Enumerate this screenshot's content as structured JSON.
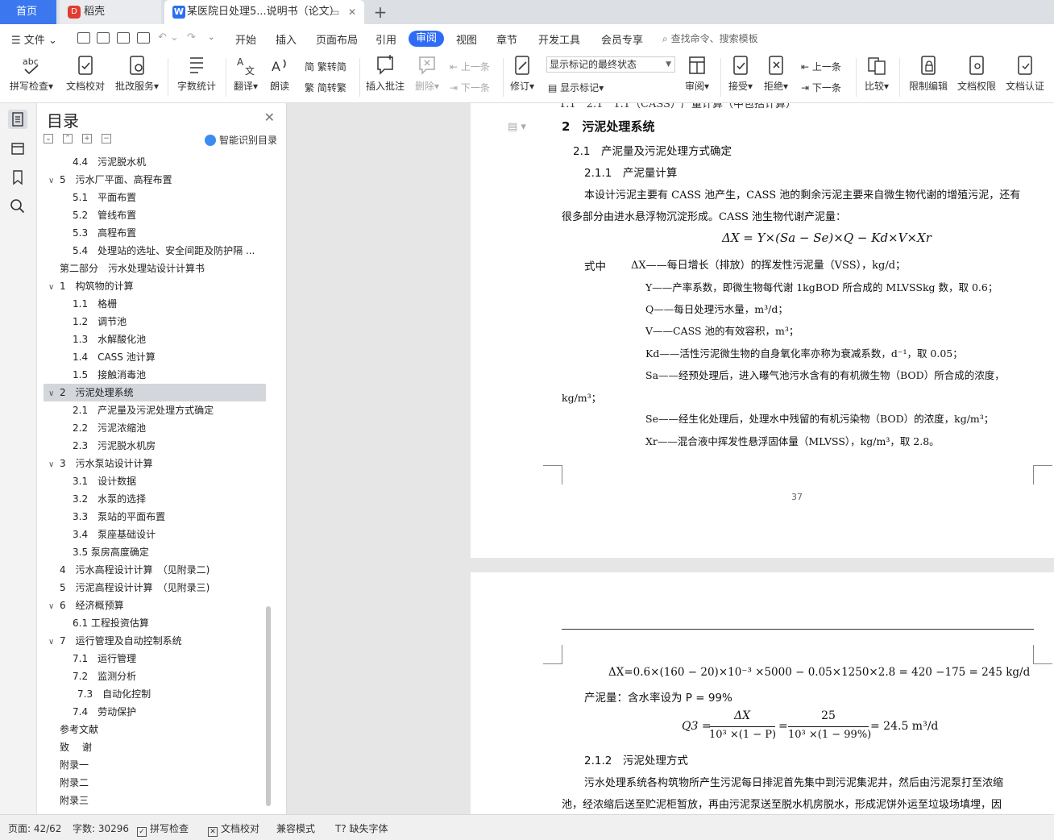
{
  "tabs": {
    "home": "首页",
    "daoke": "稻壳",
    "document": "某医院日处理5...说明书（论文）"
  },
  "menu": {
    "file": "文件",
    "items": [
      "开始",
      "插入",
      "页面布局",
      "引用",
      "审阅",
      "视图",
      "章节",
      "开发工具",
      "会员专享"
    ],
    "active": "审阅",
    "search": "查找命令、搜索模板"
  },
  "ribbon": {
    "spell_check": "拼写检查",
    "doc_check": "文档校对",
    "annot_service": "批改服务",
    "word_count": "字数统计",
    "translate": "翻译",
    "read_aloud": "朗读",
    "to_traditional": "繁转简",
    "to_simplified": "简转繁",
    "insert_comment": "插入批注",
    "delete": "删除",
    "prev_comment": "上一条",
    "next_comment": "下一条",
    "track": "修订",
    "markup_select": "显示标记的最终状态",
    "show_markup": "显示标记",
    "review": "审阅",
    "accept": "接受",
    "reject": "拒绝",
    "prev_change": "上一条",
    "next_change": "下一条",
    "compare": "比较",
    "restrict_edit": "限制编辑",
    "doc_permission": "文档权限",
    "doc_auth": "文档认证"
  },
  "toc": {
    "title": "目录",
    "smart": "智能识别目录",
    "items": [
      {
        "text": "4.4　污泥脱水机",
        "level": 2,
        "arrow": ""
      },
      {
        "text": "5　污水厂平面、高程布置",
        "level": 1,
        "arrow": "v"
      },
      {
        "text": "5.1　平面布置",
        "level": 2,
        "arrow": ""
      },
      {
        "text": "5.2　管线布置",
        "level": 2,
        "arrow": ""
      },
      {
        "text": "5.3　高程布置",
        "level": 2,
        "arrow": ""
      },
      {
        "text": "5.4　处理站的选址、安全间距及防护隔 ...",
        "level": 2,
        "arrow": ""
      },
      {
        "text": "第二部分　污水处理站设计计算书",
        "level": 0,
        "arrow": ""
      },
      {
        "text": "1　构筑物的计算",
        "level": 1,
        "arrow": "v"
      },
      {
        "text": "1.1　格栅",
        "level": 2,
        "arrow": ""
      },
      {
        "text": "1.2　调节池",
        "level": 2,
        "arrow": ""
      },
      {
        "text": "1.3　水解酸化池",
        "level": 2,
        "arrow": ""
      },
      {
        "text": "1.4　CASS 池计算",
        "level": 2,
        "arrow": ""
      },
      {
        "text": "1.5　接触消毒池",
        "level": 2,
        "arrow": ""
      },
      {
        "text": "2　污泥处理系统",
        "level": 1,
        "arrow": "v",
        "selected": true
      },
      {
        "text": "2.1　产泥量及污泥处理方式确定",
        "level": 2,
        "arrow": ""
      },
      {
        "text": "2.2　污泥浓缩池",
        "level": 2,
        "arrow": ""
      },
      {
        "text": "2.3　污泥脱水机房",
        "level": 2,
        "arrow": ""
      },
      {
        "text": "3　污水泵站设计计算",
        "level": 1,
        "arrow": "v"
      },
      {
        "text": "3.1　设计数据",
        "level": 2,
        "arrow": ""
      },
      {
        "text": "3.2　水泵的选择",
        "level": 2,
        "arrow": ""
      },
      {
        "text": "3.3　泵站的平面布置",
        "level": 2,
        "arrow": ""
      },
      {
        "text": "3.4　泵座基础设计",
        "level": 2,
        "arrow": ""
      },
      {
        "text": "3.5 泵房高度确定",
        "level": 2,
        "arrow": ""
      },
      {
        "text": "4　污水高程设计计算　（见附录二)",
        "level": 0.5,
        "arrow": ""
      },
      {
        "text": "5　污泥高程设计计算　（见附录三)",
        "level": 0.5,
        "arrow": ""
      },
      {
        "text": "6　经济概预算",
        "level": 1,
        "arrow": "v"
      },
      {
        "text": "6.1 工程投资估算",
        "level": 2,
        "arrow": ""
      },
      {
        "text": "7　运行管理及自动控制系统",
        "level": 1,
        "arrow": "v"
      },
      {
        "text": "7.1　运行管理",
        "level": 2,
        "arrow": ""
      },
      {
        "text": "7.2　监测分析",
        "level": 2,
        "arrow": ""
      },
      {
        "text": "7.3　自动化控制",
        "level": 2.3,
        "arrow": ""
      },
      {
        "text": "7.4　劳动保护",
        "level": 2,
        "arrow": ""
      },
      {
        "text": "参考文献",
        "level": 0,
        "arrow": ""
      },
      {
        "text": "致　 谢",
        "level": 0,
        "arrow": ""
      },
      {
        "text": "附录一",
        "level": 0,
        "arrow": ""
      },
      {
        "text": "附录二",
        "level": 0,
        "arrow": ""
      },
      {
        "text": "附录三",
        "level": 0,
        "arrow": ""
      }
    ]
  },
  "page1": {
    "cut_top": "1.1　2.1　1.1（CASS）产量计算（中包括计算）",
    "h2": "2　污泥处理系统",
    "h3": "2.1　产泥量及污泥处理方式确定",
    "h4": "2.1.1　产泥量计算",
    "para1_l1": "本设计污泥主要有 CASS 池产生，CASS 池的剩余污泥主要来自微生物代谢的增殖污泥，还有",
    "para1_l2": "很多部分由进水悬浮物沉淀形成。CASS 池生物代谢产泥量：",
    "formula1": "ΔX = Y×(Sa − Se)×Q − Kd×V×Xr",
    "where_label": "式中",
    "def1": "ΔX——每日增长（排放）的挥发性污泥量（VSS），kg/d；",
    "def2": "Y——产率系数，即微生物每代谢 1kgBOD 所合成的 MLVSSkg 数，取 0.6；",
    "def3": "Q——每日处理污水量，m³/d；",
    "def4": "V——CASS 池的有效容积，m³；",
    "def5": "Kd——活性污泥微生物的自身氧化率亦称为衰减系数，d⁻¹，取 0.05；",
    "def6_l1": "Sa——经预处理后，进入曝气池污水含有的有机微生物（BOD）所合成的浓度，",
    "def6_l2": "kg/m³；",
    "def7": "Se——经生化处理后，处理水中残留的有机污染物（BOD）的浓度，kg/m³；",
    "def8": "Xr——混合液中挥发性悬浮固体量（MLVSS），kg/m³，取 2.8。",
    "page_no": "37"
  },
  "page2": {
    "formula2": "ΔX=0.6×(160 − 20)×10⁻³ ×5000 − 0.05×1250×2.8 = 420 −175 = 245 kg/d",
    "sludge_line": "产泥量：含水率设为 P = 99%",
    "formula3_lhs": "Q3 =",
    "formula3_frac1_num": "ΔX",
    "formula3_frac1_den": "10³ ×(1 − P)",
    "formula3_frac2_num": "25",
    "formula3_frac2_den": "10³ ×(1 − 99%)",
    "formula3_rhs": "= 24.5 m³/d",
    "h4b": "2.1.2　污泥处理方式",
    "para2_l1": "污水处理系统各构筑物所产生污泥每日排泥首先集中到污泥集泥井，然后由污泥泵打至浓缩",
    "para2_l2": "池，经浓缩后送至贮泥柜暂放，再由污泥泵送至脱水机房脱水，形成泥饼外运至垃圾场填埋，因"
  },
  "status": {
    "page": "页面: 42/62",
    "words": "字数: 30296",
    "spell": "拼写检查",
    "proof": "文档校对",
    "compat": "兼容模式",
    "missing_font": "缺失字体"
  }
}
